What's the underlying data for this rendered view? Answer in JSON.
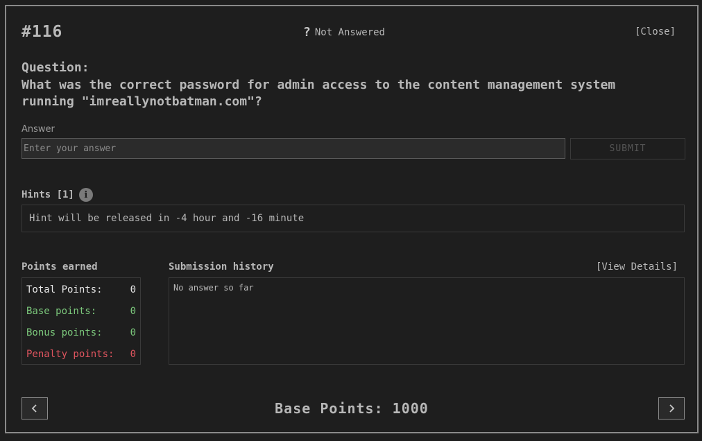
{
  "header": {
    "question_number": "#116",
    "status_icon": "?",
    "status_text": "Not Answered",
    "close_label": "[Close]"
  },
  "question": {
    "label": "Question:",
    "text": "What was the correct password for admin access to the content management system running \"imreallynotbatman.com\"?"
  },
  "answer": {
    "label": "Answer",
    "placeholder": "Enter your answer",
    "value": "",
    "submit_label": "SUBMIT"
  },
  "hints": {
    "label": "Hints [1]",
    "info_icon": "i",
    "text": "Hint will be released in -4 hour and -16 minute"
  },
  "points": {
    "label": "Points earned",
    "total_label": "Total Points:",
    "total_value": "0",
    "base_label": "Base points:",
    "base_value": "0",
    "bonus_label": "Bonus points:",
    "bonus_value": "0",
    "penalty_label": "Penalty points:",
    "penalty_value": "0"
  },
  "submission": {
    "label": "Submission history",
    "view_details_label": "[View Details]",
    "empty_text": "No answer so far"
  },
  "footer": {
    "base_points_text": "Base Points: 1000",
    "prev_icon": "chevron-left-icon",
    "next_icon": "chevron-right-icon"
  },
  "colors": {
    "background": "#1e1e1e",
    "border": "#8a8a8a",
    "text": "#b8b8b8",
    "positive": "#7cc87c",
    "penalty": "#e0555f"
  }
}
